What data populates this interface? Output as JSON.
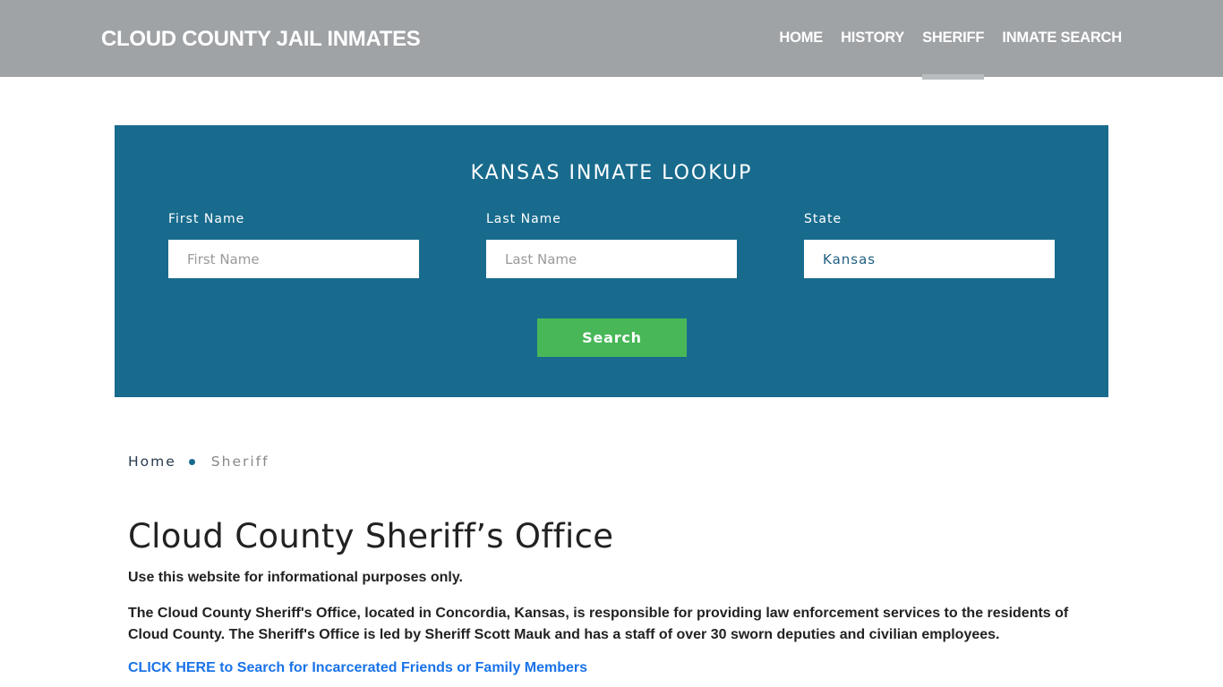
{
  "header": {
    "brand": "CLOUD COUNTY JAIL INMATES",
    "nav": [
      {
        "label": "HOME",
        "active": false
      },
      {
        "label": "HISTORY",
        "active": false
      },
      {
        "label": "SHERIFF",
        "active": true
      },
      {
        "label": "INMATE SEARCH",
        "active": false
      }
    ]
  },
  "lookup": {
    "title": "KANSAS INMATE LOOKUP",
    "first_name": {
      "label": "First Name",
      "placeholder": "First Name",
      "value": ""
    },
    "last_name": {
      "label": "Last Name",
      "placeholder": "Last Name",
      "value": ""
    },
    "state": {
      "label": "State",
      "value": "Kansas"
    },
    "search_label": "Search"
  },
  "breadcrumb": {
    "home": "Home",
    "current": "Sheriff"
  },
  "content": {
    "title": "Cloud County Sheriff’s Office",
    "disclaimer": "Use this website for informational purposes only.",
    "body": "The Cloud County Sheriff's Office, located in Concordia, Kansas, is responsible for providing law enforcement services to the residents of Cloud County. The Sheriff's Office is led by Sheriff Scott Mauk and has a staff of over 30 sworn deputies and civilian employees.",
    "cta": "CLICK HERE to Search for Incarcerated Friends or Family Members"
  },
  "colors": {
    "header_bg": "#9fa3a6",
    "lookup_bg": "#186b8d",
    "search_button": "#47b758",
    "link": "#1a73e8"
  }
}
